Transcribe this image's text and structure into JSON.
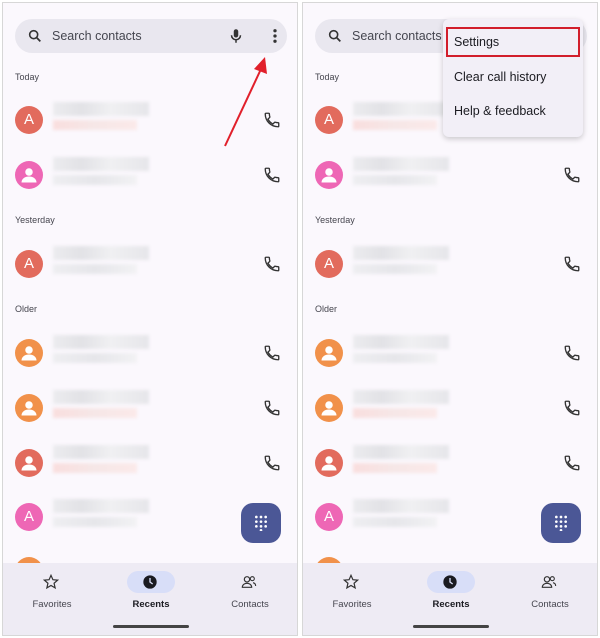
{
  "search": {
    "placeholder": "Search contacts"
  },
  "sections": {
    "today": "Today",
    "yesterday": "Yesterday",
    "older": "Older"
  },
  "nav": {
    "favorites": "Favorites",
    "recents": "Recents",
    "contacts": "Contacts"
  },
  "menu": {
    "settings": "Settings",
    "clear_history": "Clear call history",
    "help": "Help & feedback"
  },
  "avatars": {
    "letter_a": "A"
  },
  "colors": {
    "avatar_red": "#e26b5d",
    "avatar_pink": "#ee67b5",
    "avatar_orange": "#f1914a",
    "fab": "#4b5796",
    "highlight": "#d21e2b"
  },
  "icons": [
    "search-icon",
    "mic-icon",
    "more-vert-icon",
    "phone-icon",
    "dialpad-icon",
    "star-icon",
    "clock-icon",
    "people-icon"
  ]
}
